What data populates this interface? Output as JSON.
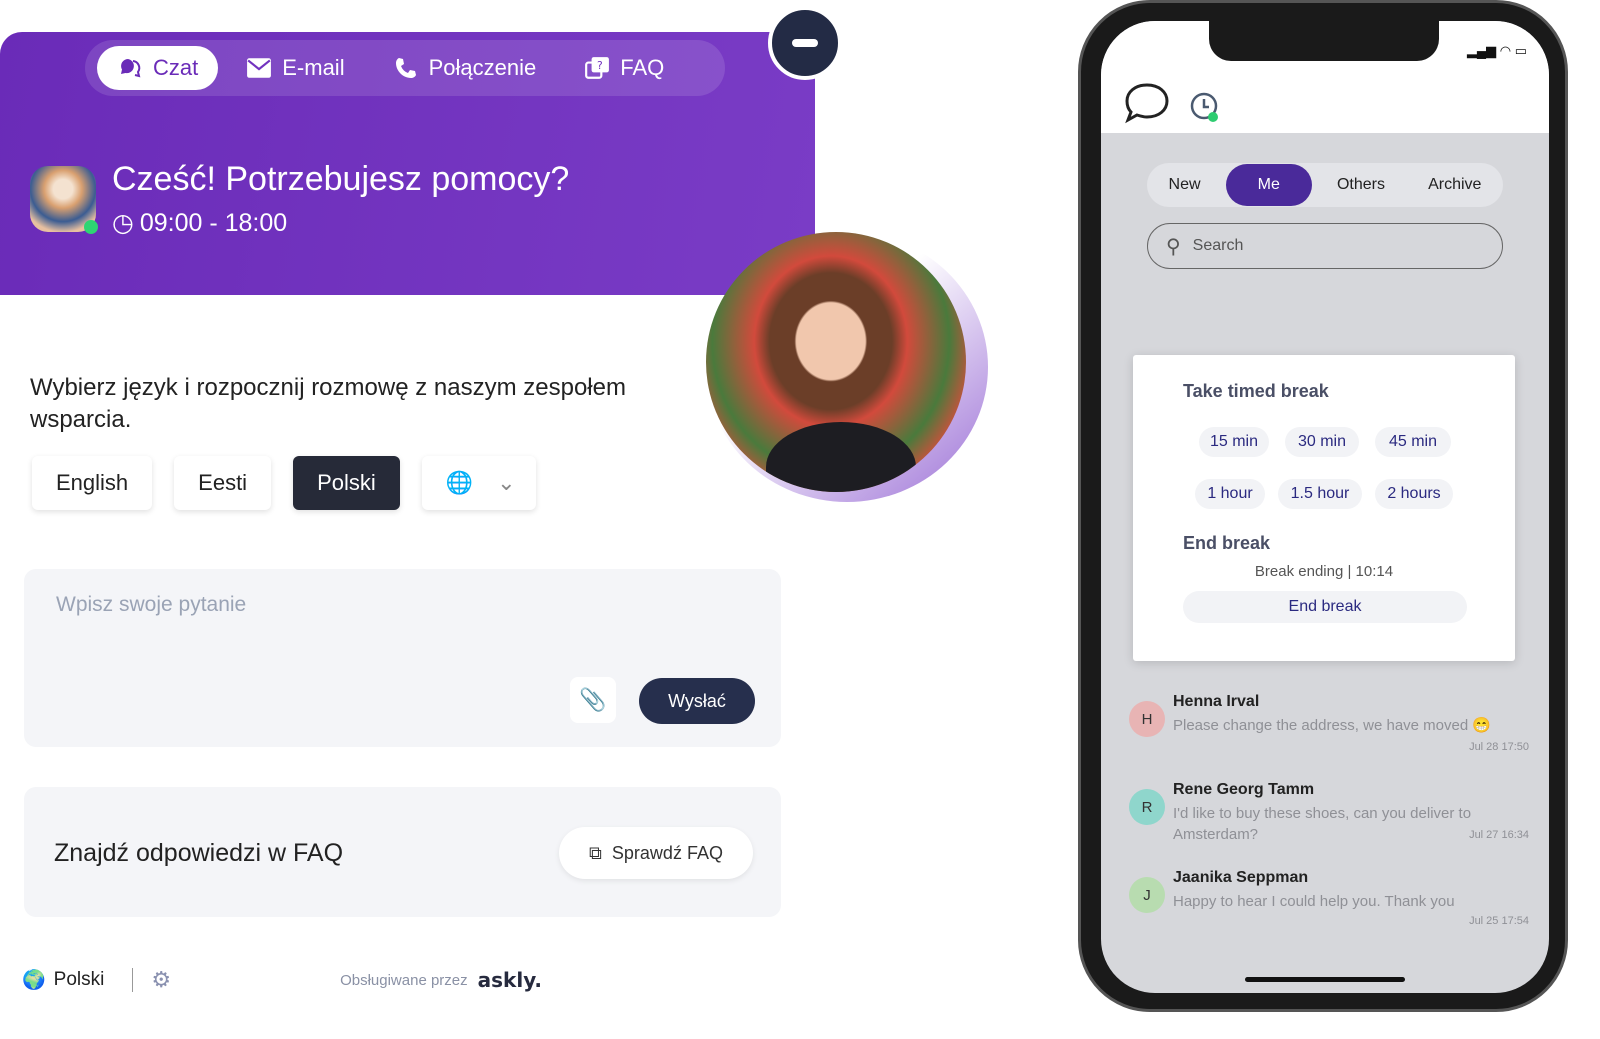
{
  "widget": {
    "tabs": [
      {
        "label": "Czat",
        "icon": "chat-icon",
        "active": true
      },
      {
        "label": "E-mail",
        "icon": "mail-icon"
      },
      {
        "label": "Połączenie",
        "icon": "phone-icon"
      },
      {
        "label": "FAQ",
        "icon": "faq-icon"
      }
    ],
    "title": "Cześć! Potrzebujesz pomocy?",
    "hours": "09:00 - 18:00",
    "intro": "Wybierz język i rozpocznij rozmowę z naszym zespołem wsparcia.",
    "languages": [
      "English",
      "Eesti",
      "Polski"
    ],
    "selected_language": "Polski",
    "question_placeholder": "Wpisz swoje pytanie",
    "send_label": "Wysłać",
    "faq_text": "Znajdź odpowiedzi w FAQ",
    "faq_button": "Sprawdź FAQ",
    "footer_language": "Polski",
    "powered_by": "Obsługiwane przez",
    "brand": "askly."
  },
  "colors": {
    "header": "#7233bf",
    "dark": "#262a38",
    "accent": "#4a2a9a"
  },
  "app": {
    "tabs": [
      "New",
      "Me",
      "Others",
      "Archive"
    ],
    "active_tab": "Me",
    "search_placeholder": "Search",
    "break_popup": {
      "title": "Take timed break",
      "options": [
        "15 min",
        "30 min",
        "45 min",
        "1 hour",
        "1.5 hour",
        "2 hours"
      ],
      "end_title": "End break",
      "ending": "Break ending | 10:14",
      "end_button": "End break"
    },
    "conversations": [
      {
        "initial": "H",
        "name": "Henna Irval",
        "message": "Please change the address, we have moved 😁",
        "date": "Jul 28 17:50",
        "color": "#e8b4b4"
      },
      {
        "initial": "R",
        "name": "Rene Georg Tamm",
        "message": "I'd like to buy these shoes, can you deliver to Amsterdam?",
        "date": "Jul 27 16:34",
        "color": "#8fd6cc"
      },
      {
        "initial": "J",
        "name": "Jaanika Seppman",
        "message": "Happy to hear I could help you. Thank you",
        "date": "Jul 25 17:54",
        "color": "#b8dcb0"
      }
    ]
  }
}
